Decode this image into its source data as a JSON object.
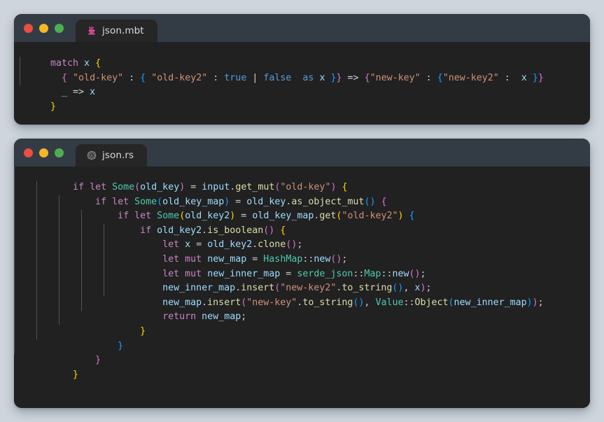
{
  "page": {
    "background_color": "#ced5dc"
  },
  "colors": {
    "titlebar": "#333c45",
    "editor_background": "#212121",
    "tab_active": "#262626",
    "traffic_red": "#ed4d42",
    "traffic_yellow": "#f5b825",
    "traffic_green": "#4cb050",
    "keyword": "#c586c0",
    "keyword_literal": "#569cd6",
    "type": "#4ec9b0",
    "function": "#dcdcaa",
    "variable": "#9cdcfe",
    "string": "#ce9178",
    "punctuation": "#cccccc",
    "bracket_level_1": "#ffd700",
    "bracket_level_2": "#da70d6",
    "bracket_level_3": "#179fff"
  },
  "windows": [
    {
      "id": "moonbit-window",
      "traffic_lights": [
        "close-button",
        "minimize-button",
        "maximize-button"
      ],
      "tab": {
        "label": "json.mbt",
        "icon": "moonbit-icon",
        "icon_color": "#e84d9c"
      },
      "language": "moonbit",
      "code_lines": [
        "match x {",
        "  { \"old-key\" : { \"old-key2\" : true | false  as x }} => {\"new-key\" : {\"new-key2\" :  x }}",
        "  _ => x",
        "}"
      ]
    },
    {
      "id": "rust-window",
      "traffic_lights": [
        "close-button",
        "minimize-button",
        "maximize-button"
      ],
      "tab": {
        "label": "json.rs",
        "icon": "rust-icon",
        "icon_color": "#8c8c8c"
      },
      "language": "rust",
      "code_lines": [
        "    if let Some(old_key) = input.get_mut(\"old-key\") {",
        "        if let Some(old_key_map) = old_key.as_object_mut() {",
        "            if let Some(old_key2) = old_key_map.get(\"old-key2\") {",
        "                if old_key2.is_boolean() {",
        "                    let x = old_key2.clone();",
        "                    let mut new_map = HashMap::new();",
        "                    let mut new_inner_map = serde_json::Map::new();",
        "                    new_inner_map.insert(\"new-key2\".to_string(), x);",
        "                    new_map.insert(\"new-key\".to_string(), Value::Object(new_inner_map));",
        "                    return new_map;",
        "                }",
        "            }",
        "        }",
        "    }"
      ]
    }
  ]
}
